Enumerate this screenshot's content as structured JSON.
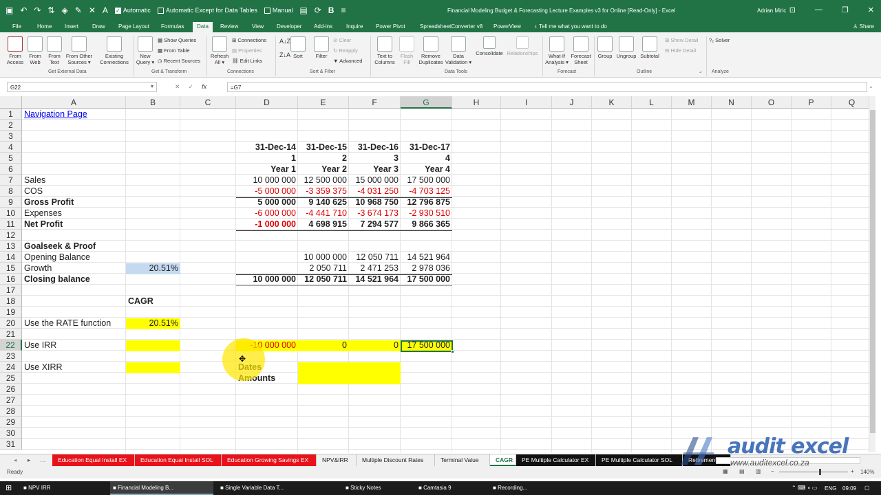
{
  "titlebar": {
    "auto_calc": "Automatic",
    "auto_except": "Automatic Except for Data Tables",
    "manual": "Manual",
    "document_title": "Financial Modeling Budget & Forecasting Lecture Examples v3 for Online [Read-Only] - Excel",
    "user": "Adrian Miric"
  },
  "tabs": [
    "File",
    "Home",
    "Insert",
    "Draw",
    "Page Layout",
    "Formulas",
    "Data",
    "Review",
    "View",
    "Developer",
    "Add-ins",
    "Inquire",
    "Power Pivot",
    "SpreadsheetConverter v8",
    "PowerView"
  ],
  "active_tab": "Data",
  "tell_me": "Tell me what you want to do",
  "share": "Share",
  "ribbon": {
    "from_access": [
      "From",
      "Access"
    ],
    "from_web": [
      "From",
      "Web"
    ],
    "from_text": [
      "From",
      "Text"
    ],
    "from_other": [
      "From Other",
      "Sources ▾"
    ],
    "existing": [
      "Existing",
      "Connections"
    ],
    "group_external": "Get External Data",
    "new_query": [
      "New",
      "Query ▾"
    ],
    "show_queries": "Show Queries",
    "from_table": "From Table",
    "recent_sources": "Recent Sources",
    "group_transform": "Get & Transform",
    "refresh_all": [
      "Refresh",
      "All ▾"
    ],
    "connections": "Connections",
    "properties": "Properties",
    "edit_links": "Edit Links",
    "group_connections": "Connections",
    "sort": "Sort",
    "filter": "Filter",
    "clear": "Clear",
    "reapply": "Reapply",
    "advanced": "Advanced",
    "group_sort": "Sort & Filter",
    "text_to_columns": [
      "Text to",
      "Columns"
    ],
    "flash_fill": [
      "Flash",
      "Fill"
    ],
    "remove_duplicates": [
      "Remove",
      "Duplicates"
    ],
    "data_validation": [
      "Data",
      "Validation ▾"
    ],
    "consolidate": "Consolidate",
    "relationships": "Relationships",
    "group_data_tools": "Data Tools",
    "what_if": [
      "What-If",
      "Analysis ▾"
    ],
    "forecast_sheet": [
      "Forecast",
      "Sheet"
    ],
    "group_forecast": "Forecast",
    "group_btn": "Group",
    "ungroup_btn": "Ungroup",
    "subtotal": "Subtotal",
    "show_detail": "Show Detail",
    "hide_detail": "Hide Detail",
    "group_outline": "Outline",
    "solver": "Solver",
    "group_analyze": "Analyze"
  },
  "formula_bar": {
    "name_box": "G22",
    "formula": "=G7"
  },
  "columns": [
    "A",
    "B",
    "C",
    "D",
    "E",
    "F",
    "G",
    "H",
    "I",
    "J",
    "K",
    "L",
    "M",
    "N",
    "O",
    "P",
    "Q"
  ],
  "rows": [
    "1",
    "2",
    "3",
    "4",
    "5",
    "6",
    "7",
    "8",
    "9",
    "10",
    "11",
    "12",
    "13",
    "14",
    "15",
    "16",
    "17",
    "18",
    "19",
    "20",
    "21",
    "22",
    "23",
    "24",
    "25",
    "26",
    "27",
    "28",
    "29",
    "30",
    "31"
  ],
  "sheet": {
    "a1": "Navigation Page",
    "dates": [
      "31-Dec-14",
      "31-Dec-15",
      "31-Dec-16",
      "31-Dec-17"
    ],
    "periods": [
      "1",
      "2",
      "3",
      "4"
    ],
    "years": [
      "Year 1",
      "Year 2",
      "Year 3",
      "Year 4"
    ],
    "sales_label": "Sales",
    "sales": [
      "10 000 000",
      "12 500 000",
      "15 000 000",
      "17 500 000"
    ],
    "cos_label": "COS",
    "cos": [
      "-5 000 000",
      "-3 359 375",
      "-4 031 250",
      "-4 703 125"
    ],
    "gp_label": "Gross Profit",
    "gp": [
      "5 000 000",
      "9 140 625",
      "10 968 750",
      "12 796 875"
    ],
    "exp_label": "Expenses",
    "exp": [
      "-6 000 000",
      "-4 441 710",
      "-3 674 173",
      "-2 930 510"
    ],
    "np_label": "Net Profit",
    "np": [
      "-1 000 000",
      "4 698 915",
      "7 294 577",
      "9 866 365"
    ],
    "goalseek_label": "Goalseek & Proof",
    "opening_label": "Opening Balance",
    "opening": [
      "10 000 000",
      "12 050 711",
      "14 521 964"
    ],
    "growth_label": "Growth",
    "growth_rate": "20.51%",
    "growth": [
      "2 050 711",
      "2 471 253",
      "2 978 036"
    ],
    "closing_label": "Closing balance",
    "closing": [
      "10 000 000",
      "12 050 711",
      "14 521 964",
      "17 500 000"
    ],
    "cagr_label": "CAGR",
    "rate_label": "Use the RATE function",
    "rate_value": "20.51%",
    "irr_label": "Use IRR",
    "irr_values": [
      "-10 000 000",
      "0",
      "0",
      "17 500 000"
    ],
    "xirr_label": "Use XIRR",
    "dates_label": "Dates",
    "amounts_label": "Amounts"
  },
  "sheet_tabs": [
    "Education Equal Install EX",
    "Education Equal Install SOL",
    "Education Growing Savings EX",
    "NPV&IRR",
    "Multiple Discount Rates",
    "Terminal Value",
    "CAGR",
    "PE Multiple Calculator EX",
    "PE Multiple Calculator SOL",
    "Retirement Sa"
  ],
  "active_sheet": "CAGR",
  "status": {
    "ready": "Ready",
    "zoom": "140%"
  },
  "watermark": {
    "brand": "audit excel",
    "url": "www.auditexcel.co.za"
  },
  "taskbar": [
    "NPV IRR",
    "Financial Modeling B...",
    "Single Variable Data T...",
    "Sticky Notes",
    "Camtasia 9",
    "Recording..."
  ],
  "tray": {
    "lang": "ENG",
    "time": "09:09"
  },
  "colors": {
    "excel_green": "#217346",
    "highlight_yellow": "#ffff00",
    "input_blue": "#c5d9f1",
    "negative_red": "#e00000"
  }
}
